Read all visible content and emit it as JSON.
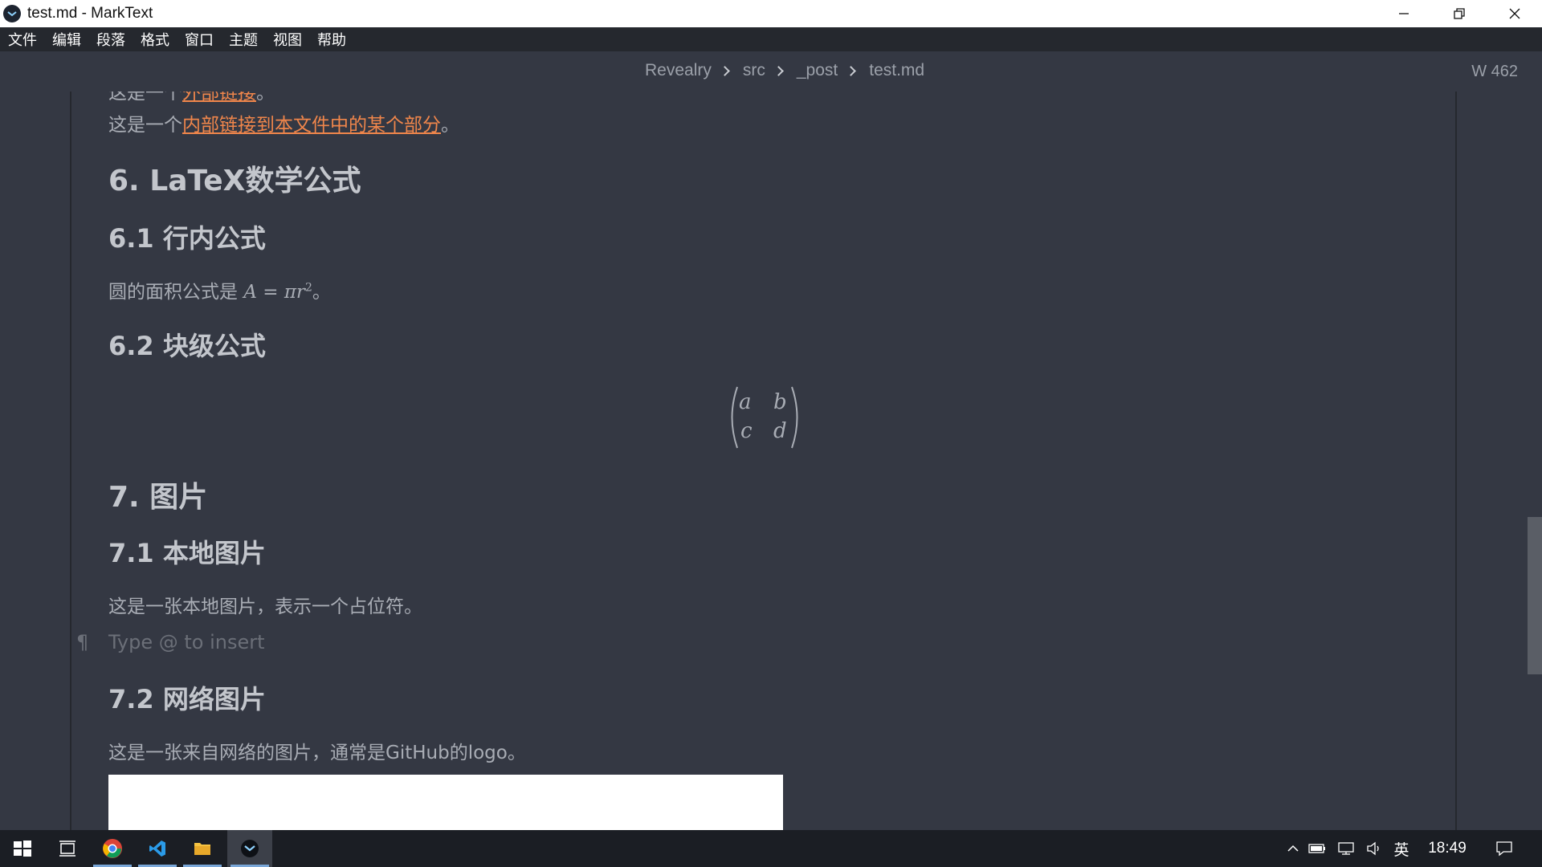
{
  "window": {
    "title": "test.md - MarkText"
  },
  "menu": {
    "items": [
      "文件",
      "编辑",
      "段落",
      "格式",
      "窗口",
      "主题",
      "视图",
      "帮助"
    ]
  },
  "header": {
    "breadcrumb": [
      "Revealry",
      "src",
      "_post",
      "test.md"
    ],
    "word_count": "W 462"
  },
  "document": {
    "cut_line_prefix": "这是一个",
    "cut_line_link": "外部链接",
    "cut_line_suffix": "。",
    "internal_link_prefix": "这是一个",
    "internal_link_text": "内部链接到本文件中的某个部分",
    "internal_link_suffix": "。",
    "h_latex": "6. LaTeX数学公式",
    "h_inline": "6.1 行内公式",
    "inline_formula_text": "圆的面积公式是 ",
    "inline_formula_math": "A = πr",
    "inline_formula_exp": "2",
    "inline_formula_end": "。",
    "h_block": "6.2 块级公式",
    "matrix": {
      "a": "a",
      "b": "b",
      "c": "c",
      "d": "d"
    },
    "h_images": "7. 图片",
    "h_local_image": "7.1 本地图片",
    "local_image_text": "这是一张本地图片，表示一个占位符。",
    "insert_placeholder": "Type @ to insert",
    "pilcrow": "¶",
    "h_web_image": "7.2 网络图片",
    "web_image_text": "这是一张来自网络的图片，通常是GitHub的logo。"
  },
  "taskbar": {
    "apps": [
      "start-icon",
      "task-view-icon",
      "chrome-icon",
      "vscode-icon",
      "file-explorer-icon",
      "marktext-icon"
    ],
    "ime": "英",
    "time": "18:49"
  },
  "colors": {
    "editor_bg": "#343843",
    "link": "#f0864b",
    "menubar_bg": "#25282e",
    "taskbar_bg": "#1b1e24"
  }
}
